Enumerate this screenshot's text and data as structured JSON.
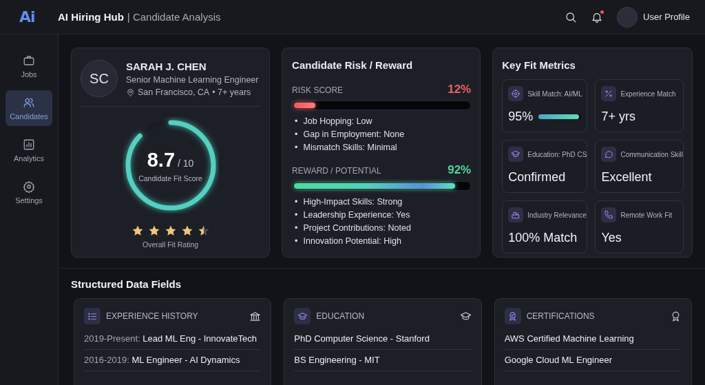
{
  "header": {
    "logo": "Ai",
    "title": "AI Hiring Hub",
    "subtitle": "| Candidate Analysis",
    "notifications_unread": true,
    "user": "User Profile"
  },
  "sidebar": {
    "items": [
      {
        "label": "Jobs",
        "selected": false
      },
      {
        "label": "Candidates",
        "selected": true
      },
      {
        "label": "Analytics",
        "selected": false
      },
      {
        "label": "Settings",
        "selected": false
      }
    ]
  },
  "profile": {
    "initials": "SC",
    "name": "SARAH J. CHEN",
    "role": "Senior Machine Learning Engineer",
    "location": "San Francisco, CA",
    "experience": "• 7+ years",
    "score": "8.7",
    "score_max": "/ 10",
    "level": 0.87,
    "score_label": "Candidate Fit Score",
    "stars": 4.5,
    "rating_label": "Overall Fit Rating"
  },
  "risk_reward": {
    "title": "Candidate Risk / Reward",
    "sections": [
      {
        "kind": "risk",
        "bullet": "•",
        "label": "RISK SCORE",
        "value": "12%",
        "level": 0.12,
        "items": [
          "Job Hopping: Low",
          "Gap in Employment: None",
          "Mismatch Skills: Minimal"
        ]
      },
      {
        "kind": "reward",
        "bullet": "•",
        "label": "REWARD / POTENTIAL",
        "value": "92%",
        "level": 0.92,
        "items": [
          "High-Impact Skills: Strong",
          "Leadership Experience: Yes",
          "Project Contributions: Noted",
          "Innovation Potential: High"
        ]
      }
    ]
  },
  "key_fit_metrics": {
    "title": "Key Fit Metrics",
    "items": [
      {
        "kind": "bar",
        "label": "Skill Match: AI/ML",
        "value": "95%",
        "level": 0.95
      },
      {
        "kind": "text",
        "label": "Experience Match",
        "value": "7+ yrs"
      },
      {
        "kind": "text",
        "label": "Education: PhD CS",
        "value": "Confirmed"
      },
      {
        "kind": "text",
        "label": "Communication Skill",
        "value": "Excellent"
      },
      {
        "kind": "text",
        "label": "Industry Relevance",
        "value": "100% Match"
      },
      {
        "kind": "text",
        "label": "Remote Work Fit",
        "value": "Yes"
      }
    ]
  },
  "structured_data": {
    "title": "Structured Data Fields",
    "cards": [
      {
        "title": "EXPERIENCE HISTORY",
        "rows": [
          {
            "prefix": "2019-Present:",
            "text": "Lead ML Eng - InnovateTech"
          },
          {
            "prefix": "2016-2019:",
            "text": "ML Engineer - AI Dynamics"
          }
        ]
      },
      {
        "title": "EDUCATION",
        "rows": [
          {
            "text": "PhD Computer Science - Stanford"
          },
          {
            "text": "BS Engineering - MIT"
          }
        ]
      },
      {
        "title": "CERTIFICATIONS",
        "rows": [
          {
            "text": "AWS Certified Machine Learning"
          },
          {
            "text": "Google Cloud ML Engineer"
          }
        ]
      }
    ]
  }
}
